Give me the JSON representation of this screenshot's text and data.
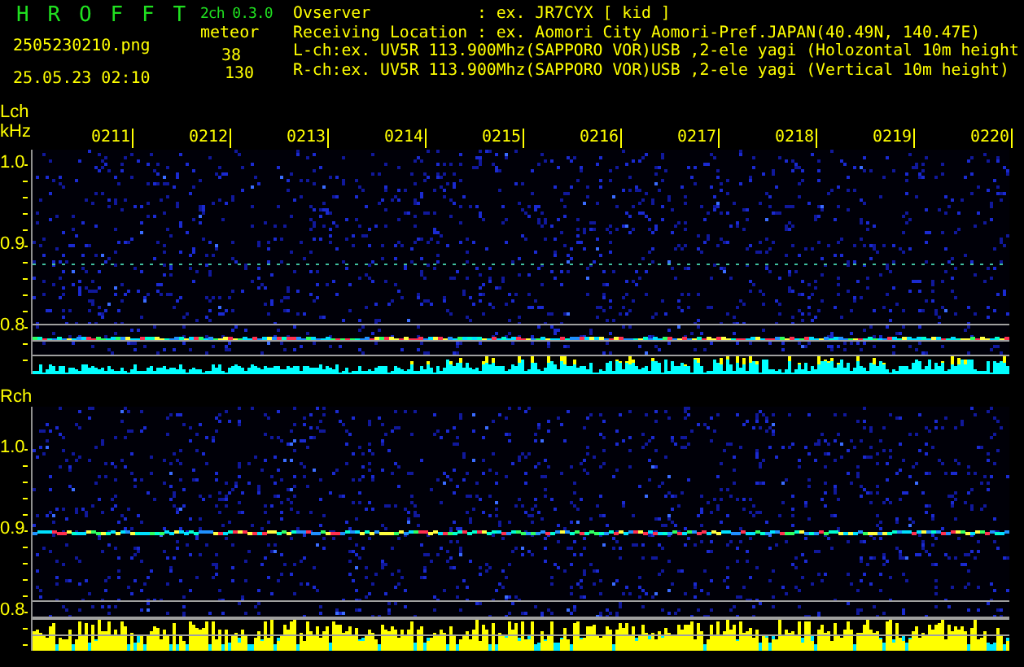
{
  "app": {
    "name": "H R O F F T",
    "version": "2ch 0.3.0"
  },
  "file": {
    "name": "2505230210.png",
    "datetime": "25.05.23 02:10"
  },
  "meteor": {
    "label": "meteor",
    "left_count": "38",
    "right_count": "130"
  },
  "info": [
    "Ovserver           : ex. JR7CYX [ kid ]",
    "Receiving Location : ex. Aomori City Aomori-Pref.JAPAN(40.49N, 140.47E)",
    "L-ch:ex. UV5R 113.900Mhz(SAPPORO VOR)USB ,2-ele yagi (Holozontal 10m height",
    "R-ch:ex. UV5R 113.900Mhz(SAPPORO VOR)USB ,2-ele yagi (Vertical 10m height)"
  ],
  "time_labels": [
    "0211",
    "0212",
    "0213",
    "0214",
    "0215",
    "0216",
    "0217",
    "0218",
    "0219",
    "0220"
  ],
  "channels": [
    {
      "name": "Lch",
      "unit": "kHz",
      "yticks": [
        "1.0",
        "0.9",
        "0.8"
      ]
    },
    {
      "name": "Rch",
      "yticks": [
        "1.0",
        "0.9",
        "0.8"
      ]
    }
  ]
}
